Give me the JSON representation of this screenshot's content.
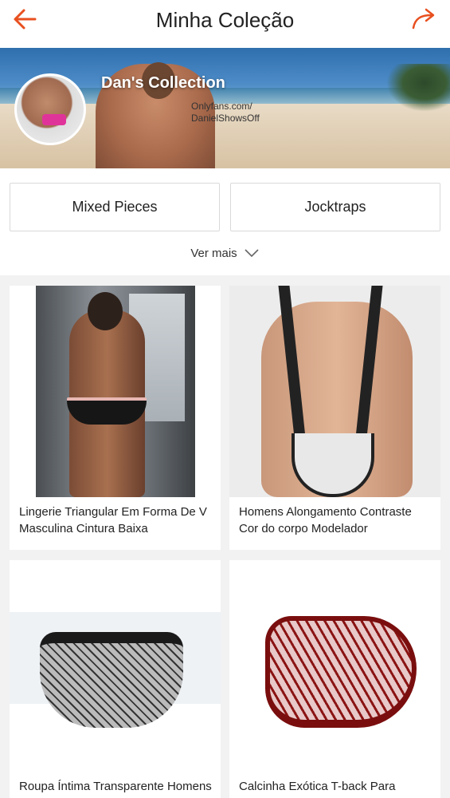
{
  "header": {
    "title": "Minha Coleção",
    "back_icon": "arrow-left-icon",
    "share_icon": "share-arrow-icon",
    "accent_color": "#e8501f"
  },
  "banner": {
    "collection_name": "Dan's Collection",
    "watermark": "Onlyfans.com/\nDanielShowsOff"
  },
  "tags": [
    {
      "label": "Mixed Pieces"
    },
    {
      "label": "Jocktraps"
    }
  ],
  "more": {
    "label": "Ver mais",
    "icon": "chevron-down-icon"
  },
  "products": [
    {
      "name": "Lingerie Triangular Em Forma De V Masculina Cintura Baixa"
    },
    {
      "name": "Homens Alongamento Contraste Cor do corpo Modelador"
    },
    {
      "name": "Roupa Íntima Transparente Homens Cueca Sexy"
    },
    {
      "name": "Calcinha Exótica T-back Para Homens Renda"
    }
  ]
}
